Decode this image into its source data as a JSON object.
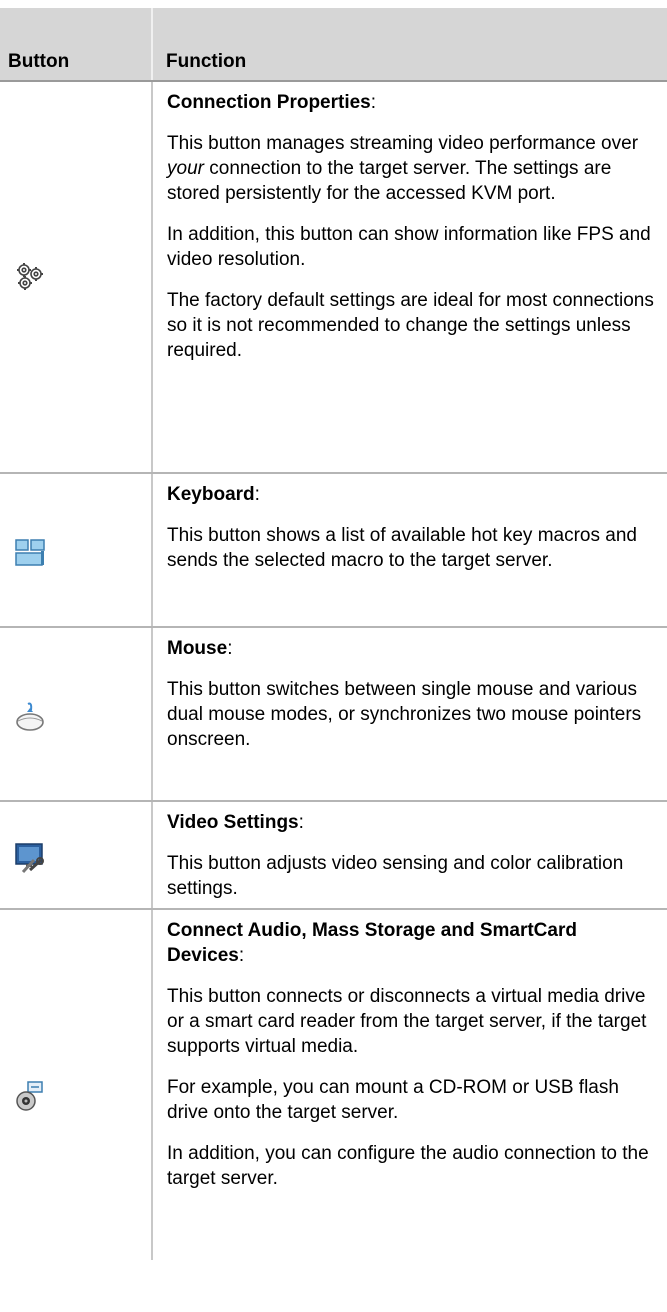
{
  "header": {
    "button": "Button",
    "function": "Function"
  },
  "rows": [
    {
      "icon": "gears-icon",
      "title": "Connection Properties",
      "paragraphs": [
        {
          "pre": "This button manages streaming video performance over ",
          "em": "your",
          "post": " connection to the target server. The settings are stored persistently for the accessed KVM port."
        },
        {
          "pre": "In addition, this button can show information like FPS and video resolution."
        },
        {
          "pre": "The factory default settings are ideal for most connections so it is not recommended to change the settings unless required."
        }
      ]
    },
    {
      "icon": "keyboard-icon",
      "title": "Keyboard",
      "paragraphs": [
        {
          "pre": "This button shows a list of available hot key macros and sends the selected macro to the target server."
        }
      ]
    },
    {
      "icon": "mouse-icon",
      "title": "Mouse",
      "paragraphs": [
        {
          "pre": "This button switches between single mouse and various dual mouse modes, or synchronizes two mouse pointers onscreen."
        }
      ]
    },
    {
      "icon": "video-settings-icon",
      "title": "Video Settings",
      "paragraphs": [
        {
          "pre": "This button adjusts video sensing and color calibration settings."
        }
      ]
    },
    {
      "icon": "virtual-media-icon",
      "title": "Connect Audio, Mass Storage and SmartCard Devices",
      "paragraphs": [
        {
          "pre": "This button connects or disconnects a virtual media drive or a smart card reader from the target server, if the target supports virtual media."
        },
        {
          "pre": "For example, you can mount a CD-ROM or USB flash drive onto the target server."
        },
        {
          "pre": "In addition, you can configure the audio connection to the target server."
        }
      ]
    }
  ]
}
